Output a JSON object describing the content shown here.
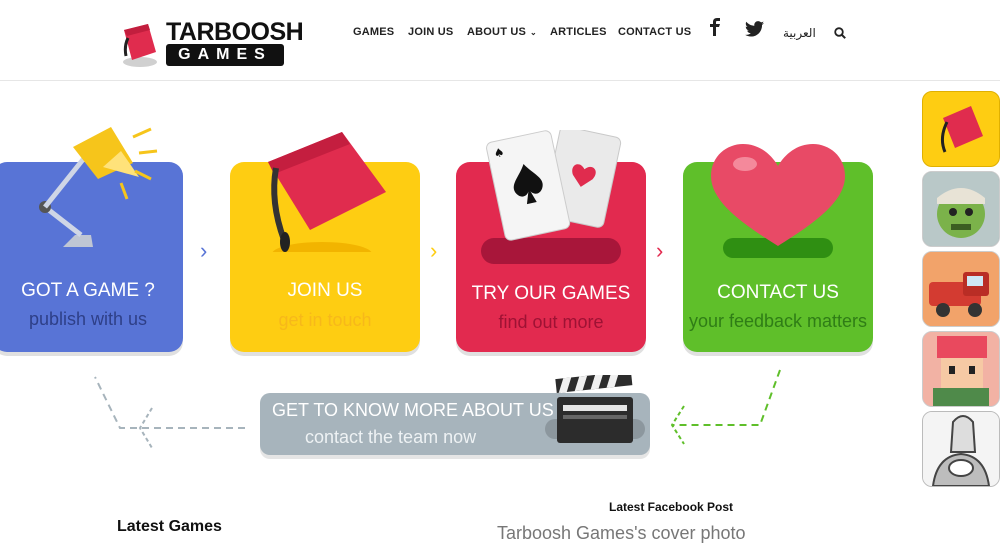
{
  "header": {
    "logo_top": "TARBOOSH",
    "logo_bottom": "GAMES",
    "nav": [
      "GAMES",
      "JOIN US",
      "ABOUT US",
      "ARTICLES",
      "CONTACT US"
    ],
    "arabic_label": "العربية",
    "icons": [
      "facebook-icon",
      "twitter-icon",
      "search-icon"
    ]
  },
  "cards": [
    {
      "title": "GOT A GAME ?",
      "subtitle": "publish with us",
      "color": "#5874d6"
    },
    {
      "title": "JOIN US",
      "subtitle": "get in touch",
      "color": "#fecd12"
    },
    {
      "title": "TRY OUR GAMES",
      "subtitle": "find out more",
      "color": "#e22a4f"
    },
    {
      "title": "CONTACT US",
      "subtitle": "your feedback matters",
      "color": "#5fbf2a"
    }
  ],
  "about": {
    "title": "GET TO KNOW MORE ABOUT US",
    "subtitle": "contact the team now"
  },
  "sections": {
    "latest_games": "Latest Games",
    "latest_facebook": "Latest Facebook Post",
    "cover_photo": "Tarboosh Games's cover photo"
  },
  "colors": {
    "blue": "#5874d6",
    "yellow": "#fecd12",
    "red": "#e22a4f",
    "green": "#5fbf2a",
    "grey": "#a7b4bc"
  }
}
